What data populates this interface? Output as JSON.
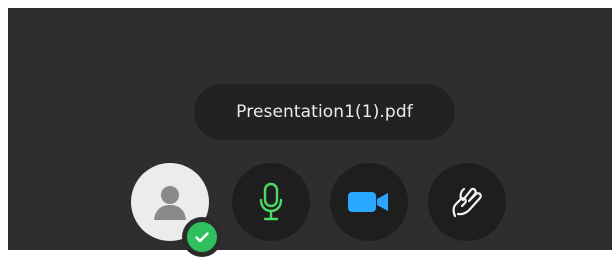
{
  "presentation": {
    "file_name": "Presentation1(1).pdf"
  },
  "controls": {
    "avatar": {
      "icon": "user-avatar-icon",
      "status": "joined",
      "status_icon": "check-icon"
    },
    "microphone": {
      "icon": "microphone-icon",
      "state": "on"
    },
    "camera": {
      "icon": "video-camera-icon",
      "state": "on"
    },
    "hand": {
      "icon": "raise-hand-icon"
    }
  },
  "colors": {
    "background": "#2e2e2e",
    "button": "#1e1e1e",
    "mic_active": "#4cd964",
    "camera_active": "#2aa7ff",
    "status_ok": "#2fbf5e",
    "text": "#ececec"
  }
}
